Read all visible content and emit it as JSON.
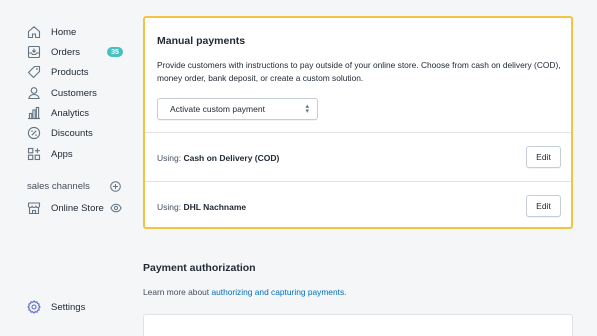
{
  "sidebar": {
    "items": [
      {
        "label": "Home",
        "icon": "home-icon"
      },
      {
        "label": "Orders",
        "icon": "orders-icon",
        "badge": "35"
      },
      {
        "label": "Products",
        "icon": "tag-icon"
      },
      {
        "label": "Customers",
        "icon": "person-icon"
      },
      {
        "label": "Analytics",
        "icon": "bar-chart-icon"
      },
      {
        "label": "Discounts",
        "icon": "discount-icon"
      },
      {
        "label": "Apps",
        "icon": "apps-icon"
      }
    ],
    "sales_channels_label": "sales channels",
    "online_store_label": "Online Store",
    "settings_label": "Settings",
    "badge_color": "#47c1bf"
  },
  "manual_payments": {
    "title": "Manual payments",
    "description": "Provide customers with instructions to pay outside of your online store. Choose from cash on delivery (COD), money order, bank deposit, or create a custom solution.",
    "select_value": "Activate custom payment",
    "methods": [
      {
        "prefix": "Using:",
        "name": "Cash on Delivery (COD)",
        "button": "Edit"
      },
      {
        "prefix": "Using:",
        "name": "DHL Nachname",
        "button": "Edit"
      }
    ],
    "highlight_color": "#f5c342"
  },
  "payment_authorization": {
    "title": "Payment authorization",
    "desc_prefix": "Learn more about",
    "link_text": "authorizing and capturing payments",
    "desc_suffix": "."
  }
}
